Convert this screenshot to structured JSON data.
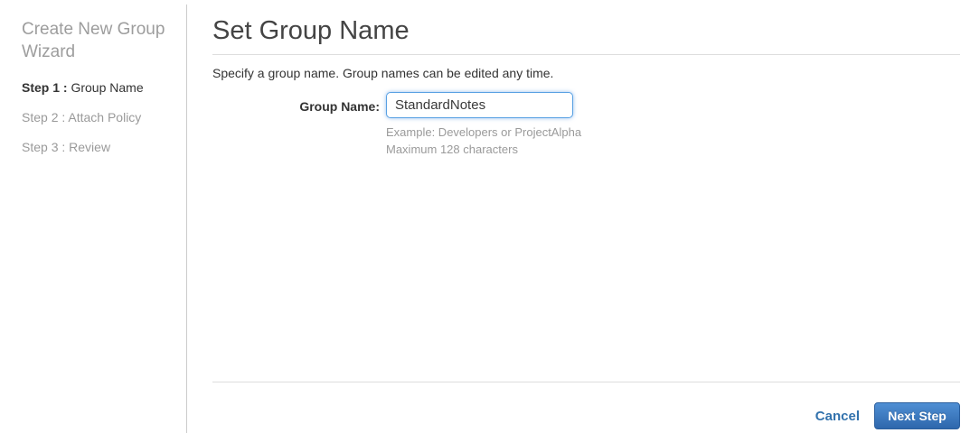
{
  "sidebar": {
    "title": "Create New Group Wizard",
    "steps": [
      {
        "prefix": "Step 1 :",
        "label": " Group Name",
        "active": true
      },
      {
        "prefix": "Step 2 :",
        "label": " Attach Policy",
        "active": false
      },
      {
        "prefix": "Step 3 :",
        "label": " Review",
        "active": false
      }
    ]
  },
  "main": {
    "title": "Set Group Name",
    "description": "Specify a group name. Group names can be edited any time.",
    "form": {
      "label": "Group Name:",
      "value": "StandardNotes",
      "hint_example": "Example: Developers or ProjectAlpha",
      "hint_max": "Maximum 128 characters"
    }
  },
  "footer": {
    "cancel_label": "Cancel",
    "next_label": "Next Step"
  },
  "colors": {
    "link_blue": "#3272ad",
    "button_gradient_top": "#4f8fd4",
    "button_gradient_bottom": "#2e67ac",
    "input_focus_border": "#59a1e3",
    "muted_text": "#9a9a9a",
    "divider": "#cccccc"
  }
}
